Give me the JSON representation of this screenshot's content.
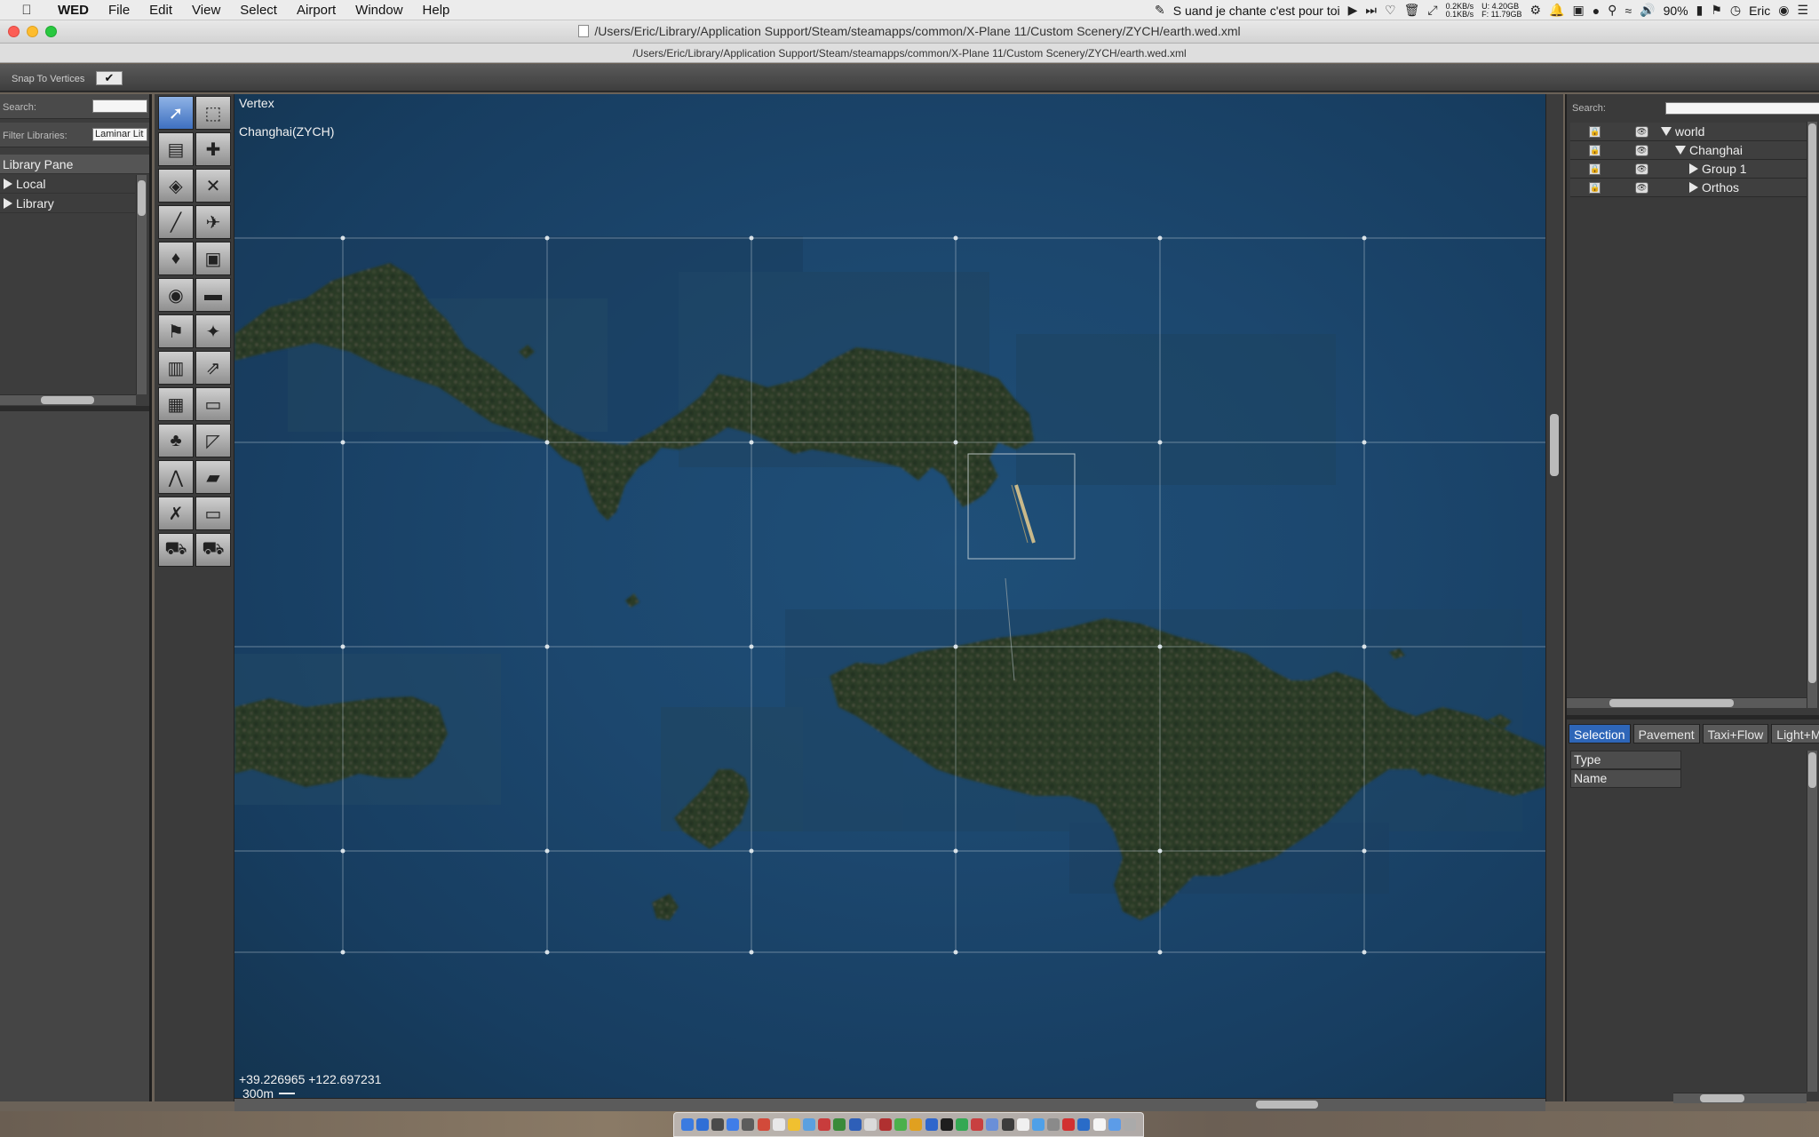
{
  "menubar": {
    "app": "WED",
    "items": [
      "File",
      "Edit",
      "View",
      "Select",
      "Airport",
      "Window",
      "Help"
    ],
    "now_playing": "S uand je chante c'est pour toi",
    "net_up": "0.2KB/s",
    "net_down": "0.1KB/s",
    "mem_used": "U: 4.20GB",
    "mem_free": "F: 11.79GB",
    "battery": "90%",
    "user": "Eric"
  },
  "window": {
    "title": "/Users/Eric/Library/Application Support/Steam/steamapps/common/X-Plane 11/Custom Scenery/ZYCH/earth.wed.xml",
    "path": "/Users/Eric/Library/Application Support/Steam/steamapps/common/X-Plane 11/Custom Scenery/ZYCH/earth.wed.xml"
  },
  "toolbar": {
    "snap_label": "Snap To Vertices",
    "snap_checked": "✔"
  },
  "library": {
    "search_label": "Search:",
    "search_value": "",
    "filter_label": "Filter Libraries:",
    "filter_value": "Laminar Lit",
    "pane_title": "Library Pane",
    "items": [
      "Local",
      "Library"
    ]
  },
  "map": {
    "tool_name": "Vertex",
    "airport_name": "Changhai(ZYCH)",
    "coordinates": "+39.226965 +122.697231",
    "scale_label": "300m"
  },
  "hierarchy": {
    "search_label": "Search:",
    "items": [
      {
        "name": "world",
        "level": 0,
        "expanded": true
      },
      {
        "name": "Changhai",
        "level": 1,
        "expanded": true
      },
      {
        "name": "Group 1",
        "level": 2,
        "expanded": false
      },
      {
        "name": "Orthos",
        "level": 2,
        "expanded": false
      }
    ]
  },
  "property_tabs": [
    "Selection",
    "Pavement",
    "Taxi+Flow",
    "Light+Ma"
  ],
  "properties": [
    "Type",
    "Name"
  ],
  "icons": {
    "apple": "apple-icon",
    "tools": [
      "vertex-tool-icon",
      "marquee-tool-icon",
      "runway-tool-icon",
      "helipad-tool-icon",
      "taxiway-tool-icon",
      "hold-line-tool-icon",
      "line-marking-tool-icon",
      "boundary-tool-icon",
      "light-fixture-tool-icon",
      "sign-tool-icon",
      "ramp-start-tool-icon",
      "windsock-tool-icon",
      "tower-viewpoint-tool-icon",
      "beacon-tool-icon",
      "facade-tool-icon",
      "atc-tool-icon",
      "object-tool-icon",
      "string-tool-icon",
      "forest-tool-icon",
      "polygon-tool-icon",
      "line-tool-icon",
      "draped-polygon-tool-icon",
      "exclusion-tool-icon",
      "blank-tool-icon",
      "truck-parking-tool-icon",
      "truck-destination-tool-icon"
    ]
  },
  "colors": {
    "water": "#1c476e",
    "land": "#2c3a26",
    "grid": "#c8d4dc",
    "selected_tab": "#2e66b8"
  }
}
